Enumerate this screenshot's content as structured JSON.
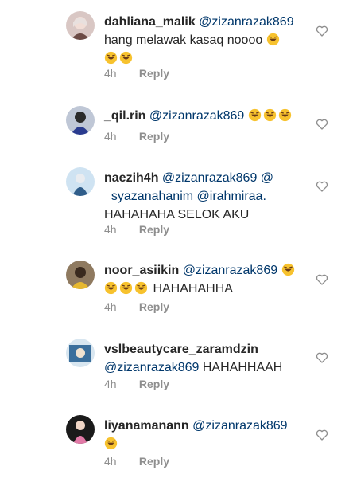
{
  "comments": [
    {
      "username": "dahliana_malik",
      "mention": "@zizanrazak869",
      "text_line1": "hang melawak kasaq noooo",
      "emoji_line1": 1,
      "emoji_line2": 2,
      "time": "4h",
      "reply": "Reply",
      "avatar_colors": [
        "#d9c7c4",
        "#6b4a45"
      ]
    },
    {
      "username": "_qil.rin",
      "mention": "@zizanrazak869",
      "emoji_line1": 3,
      "time": "4h",
      "reply": "Reply",
      "avatar_colors": [
        "#bfc7d6",
        "#2a3b8f"
      ]
    },
    {
      "username": "naezih4h",
      "mention": "@zizanrazak869 @",
      "mention_line2": "_syazanahanim @irahmiraa.____",
      "text_line3": "HAHAHAHA SELOK AKU",
      "time": "4h",
      "reply": "Reply",
      "avatar_colors": [
        "#cfe3f2",
        "#2f5d8a"
      ]
    },
    {
      "username": "noor_asiikin",
      "mention": "@zizanrazak869",
      "emoji_line1": 1,
      "emoji_line2": 3,
      "text_line2": "HAHAHAHHA",
      "time": "4h",
      "reply": "Reply",
      "avatar_colors": [
        "#8f7a60",
        "#e6b830"
      ]
    },
    {
      "username": "vslbeautycare_zaramdzin",
      "mention": "@zizanrazak869",
      "text_line2": "HAHAHHAAH",
      "time": "4h",
      "reply": "Reply",
      "avatar_colors": [
        "#d8e6f0",
        "#3b6f9c"
      ]
    },
    {
      "username": "liyanamanann",
      "mention": "@zizanrazak869",
      "emoji_line2": 1,
      "time": "4h",
      "reply": "Reply",
      "avatar_colors": [
        "#1a1a1a",
        "#e27aa7"
      ]
    }
  ],
  "icons": {
    "emoji": "rolling-on-the-floor-laughing-emoji",
    "like": "heart-outline-icon"
  },
  "colors": {
    "username": "#262626",
    "mention": "#00376b",
    "meta": "#8e8e8e",
    "emoji": "#f7c22e"
  }
}
